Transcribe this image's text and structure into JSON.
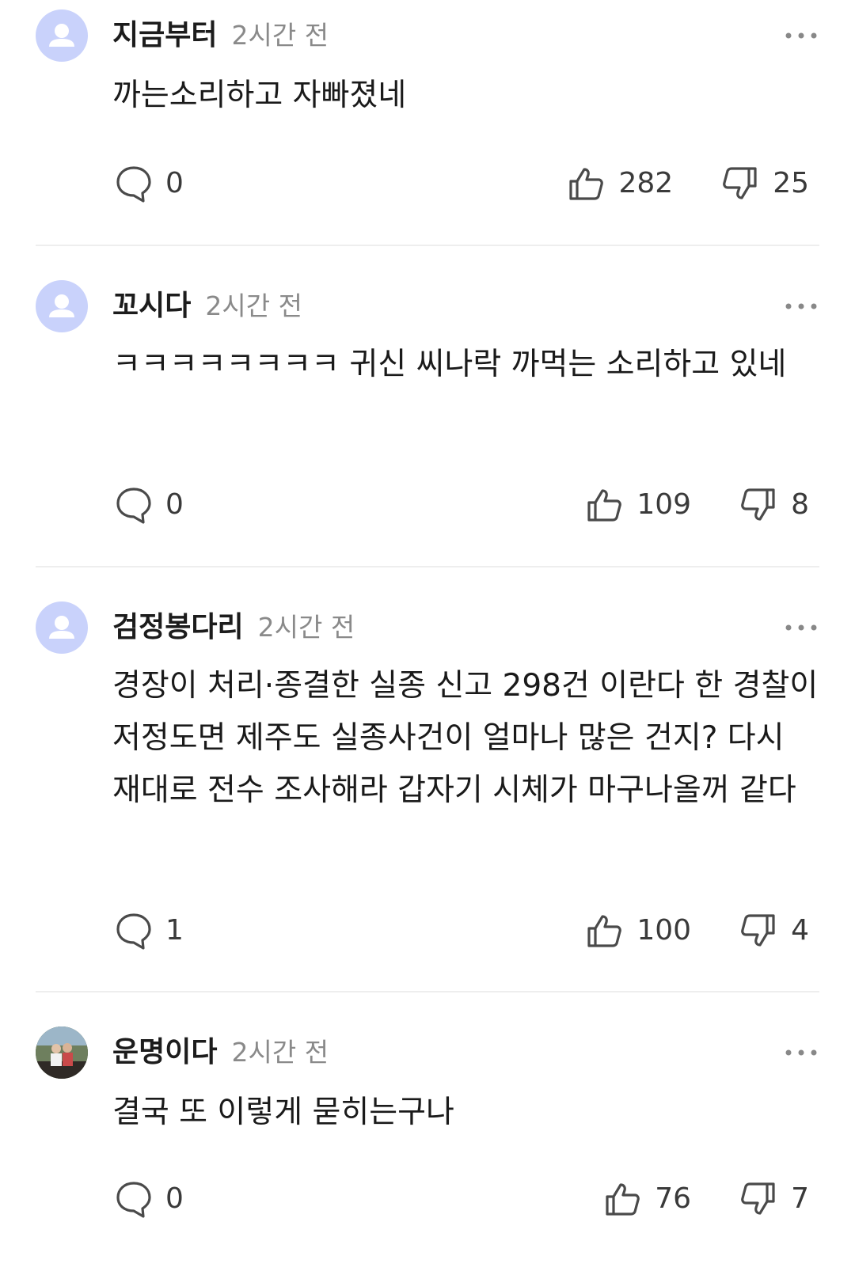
{
  "comments": [
    {
      "author": "지금부터",
      "time": "2시간 전",
      "text": "까는소리하고 자빠졌네",
      "replies": "0",
      "likes": "282",
      "dislikes": "25",
      "avatar": "default-user-icon"
    },
    {
      "author": "꼬시다",
      "time": "2시간 전",
      "text": "ㅋㅋㅋㅋㅋㅋㅋㅋ 귀신 씨나락 까먹는 소리하고 있네",
      "replies": "0",
      "likes": "109",
      "dislikes": "8",
      "avatar": "default-user-icon"
    },
    {
      "author": "검정봉다리",
      "time": "2시간 전",
      "text": "경장이 처리·종결한 실종 신고 298건 이란다 한 경찰이 저정도면 제주도 실종사건이 얼마나 많은 건지? 다시 재대로 전수 조사해라 갑자기 시체가 마구나올꺼 같다",
      "replies": "1",
      "likes": "100",
      "dislikes": "4",
      "avatar": "default-user-icon"
    },
    {
      "author": "운명이다",
      "time": "2시간 전",
      "text": "결국 또 이렇게 묻히는구나",
      "replies": "0",
      "likes": "76",
      "dislikes": "7",
      "avatar": "photo-avatar"
    }
  ],
  "colors": {
    "avatar_bg": "#c9d2fb",
    "icon": "#4a4a4a",
    "divider": "#eeeeee",
    "time": "#8a8a8a"
  }
}
